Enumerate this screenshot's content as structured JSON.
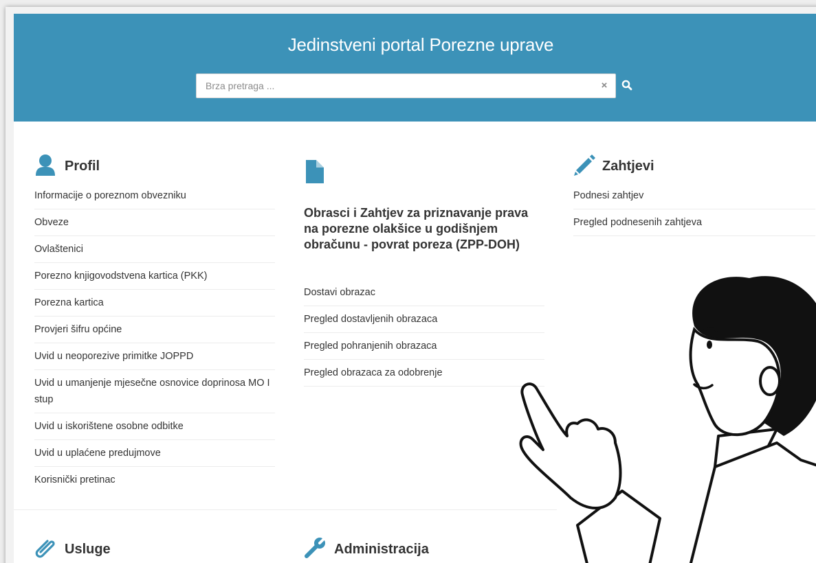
{
  "header": {
    "title": "Jedinstveni portal Porezne uprave",
    "search_placeholder": "Brza pretraga ...",
    "search_value": "",
    "clear_label": "×"
  },
  "colors": {
    "header_bg": "#3c92b8",
    "icon_accent": "#3c92b8",
    "text": "#333333"
  },
  "profil": {
    "title": "Profil",
    "icon": "user-icon",
    "items": [
      "Informacije o poreznom obvezniku",
      "Obveze",
      "Ovlaštenici",
      "Porezno knjigovodstvena kartica (PKK)",
      "Porezna kartica",
      "Provjeri šifru općine",
      "Uvid u neoporezive primitke JOPPD",
      "Uvid u umanjenje mjesečne osnovice doprinosa MO I stup",
      "Uvid u iskorištene osobne odbitke",
      "Uvid u uplaćene predujmove",
      "Korisnički pretinac"
    ]
  },
  "obrasci": {
    "title": "Obrasci i Zahtjev za priznavanje prava na porezne olakšice u godišnjem obračunu - povrat poreza (ZPP-DOH)",
    "icon": "document-icon",
    "items": [
      "Dostavi obrazac",
      "Pregled dostavljenih obrazaca",
      "Pregled pohranjenih obrazaca",
      "Pregled obrazaca za odobrenje"
    ]
  },
  "zahtjevi": {
    "title": "Zahtjevi",
    "icon": "pencil-icon",
    "items": [
      "Podnesi zahtjev",
      "Pregled podnesenih zahtjeva"
    ]
  },
  "usluge": {
    "title": "Usluge",
    "icon": "paperclip-icon"
  },
  "administracija": {
    "title": "Administracija",
    "icon": "wrench-icon"
  }
}
